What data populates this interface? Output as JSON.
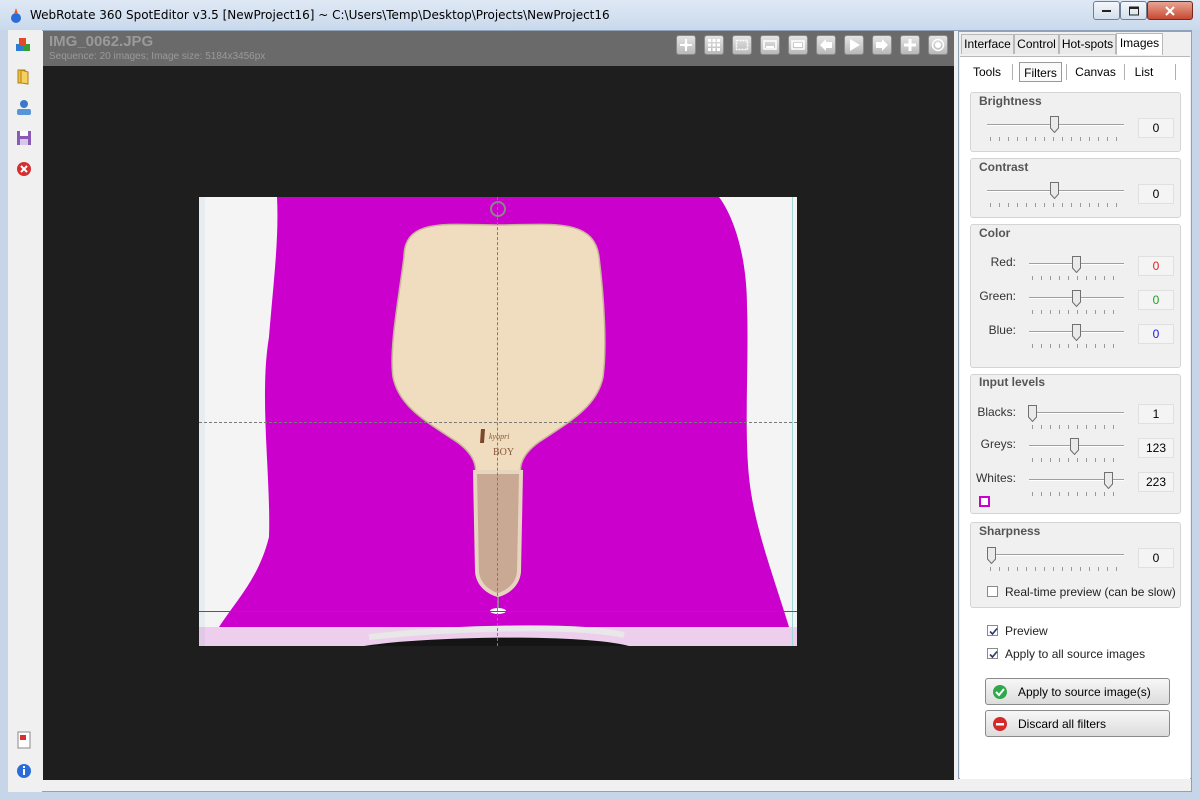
{
  "window": {
    "title": "WebRotate 360 SpotEditor v3.5 [NewProject16] ~ C:\\Users\\Temp\\Desktop\\Projects\\NewProject16"
  },
  "left_toolbar": {
    "items": [
      "blocks-icon",
      "folder-icon",
      "user-icon",
      "save-icon",
      "close-red-icon",
      "pdf-icon",
      "info-icon"
    ]
  },
  "viewer": {
    "image_name": "IMG_0062.JPG",
    "sequence_info": "Sequence: 20 images; Image size: 5184x3456px",
    "toolbar_icons": [
      "move-icon",
      "grid-icon",
      "selection-icon",
      "filmstrip-icon",
      "fit-icon",
      "arrow-left-icon",
      "play-icon",
      "arrow-right-icon",
      "plus-icon",
      "record-icon"
    ]
  },
  "tabs": {
    "main": [
      "Interface",
      "Control",
      "Hot-spots",
      "Images"
    ],
    "active_main": "Images",
    "sub": [
      "Tools",
      "Filters",
      "Canvas",
      "List"
    ],
    "active_sub": "Filters"
  },
  "filters": {
    "brightness": {
      "title": "Brightness",
      "value": "0"
    },
    "contrast": {
      "title": "Contrast",
      "value": "0"
    },
    "color": {
      "title": "Color",
      "red": {
        "label": "Red:",
        "value": "0",
        "color": "#e02020"
      },
      "green": {
        "label": "Green:",
        "value": "0",
        "color": "#20a020"
      },
      "blue": {
        "label": "Blue:",
        "value": "0",
        "color": "#2020d0"
      }
    },
    "input_levels": {
      "title": "Input levels",
      "blacks": {
        "label": "Blacks:",
        "value": "1"
      },
      "greys": {
        "label": "Greys:",
        "value": "123"
      },
      "whites": {
        "label": "Whites:",
        "value": "223"
      },
      "overlay_color": "#cc00cc"
    },
    "sharpness": {
      "title": "Sharpness",
      "value": "0"
    },
    "realtime_preview": {
      "label": "Real-time preview (can be slow)",
      "checked": false
    }
  },
  "options": {
    "preview": {
      "label": "Preview",
      "checked": true
    },
    "apply_all": {
      "label": "Apply to all source images",
      "checked": true
    }
  },
  "buttons": {
    "apply": "Apply to source image(s)",
    "discard": "Discard all filters"
  },
  "paddle": {
    "brand_line1": "kyopri",
    "brand_line2": "BOY"
  }
}
